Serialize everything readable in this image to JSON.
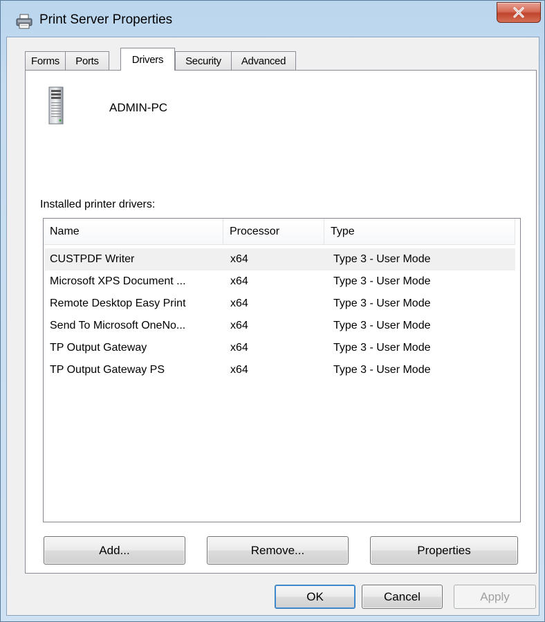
{
  "window": {
    "title": "Print Server Properties"
  },
  "tabs": [
    {
      "label": "Forms",
      "active": false
    },
    {
      "label": "Ports",
      "active": false
    },
    {
      "label": "Drivers",
      "active": true
    },
    {
      "label": "Security",
      "active": false
    },
    {
      "label": "Advanced",
      "active": false
    }
  ],
  "server": {
    "name": "ADMIN-PC"
  },
  "drivers": {
    "label": "Installed printer drivers:",
    "columns": [
      "Name",
      "Processor",
      "Type"
    ],
    "rows": [
      {
        "name": "CUSTPDF Writer",
        "processor": "x64",
        "type": "Type 3 - User Mode",
        "selected": true
      },
      {
        "name": "Microsoft XPS Document ...",
        "processor": "x64",
        "type": "Type 3 - User Mode"
      },
      {
        "name": "Remote Desktop Easy Print",
        "processor": "x64",
        "type": "Type 3 - User Mode"
      },
      {
        "name": "Send To Microsoft OneNo...",
        "processor": "x64",
        "type": "Type 3 - User Mode"
      },
      {
        "name": "TP Output Gateway",
        "processor": "x64",
        "type": "Type 3 - User Mode"
      },
      {
        "name": "TP Output Gateway PS",
        "processor": "x64",
        "type": "Type 3 - User Mode"
      }
    ]
  },
  "buttons": {
    "add": "Add...",
    "remove": "Remove...",
    "properties": "Properties",
    "ok": "OK",
    "cancel": "Cancel",
    "apply": "Apply"
  },
  "icons": {
    "title": "printer-icon",
    "close": "close-icon",
    "server": "server-icon"
  }
}
